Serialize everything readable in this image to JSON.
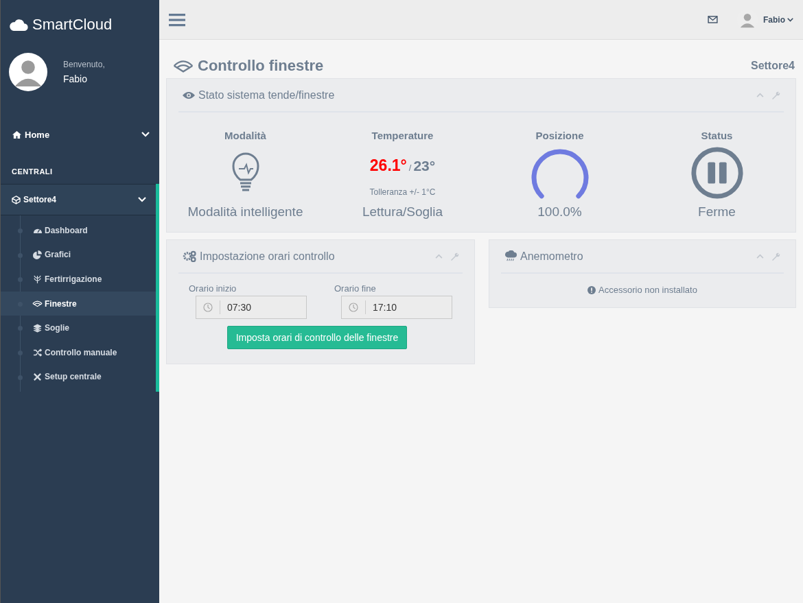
{
  "brand": "SmartCloud",
  "profile": {
    "greeting": "Benvenuto,",
    "name": "Fabio"
  },
  "nav": {
    "home": {
      "label": "Home"
    },
    "section_title": "CENTRALI",
    "group": {
      "label": "Settore4",
      "expanded": true,
      "items": [
        {
          "label": "Dashboard",
          "selected": false
        },
        {
          "label": "Grafici",
          "selected": false
        },
        {
          "label": "Fertirrigazione",
          "selected": false
        },
        {
          "label": "Finestre",
          "selected": true
        },
        {
          "label": "Soglie",
          "selected": false
        },
        {
          "label": "Controllo manuale",
          "selected": false
        },
        {
          "label": "Setup centrale",
          "selected": false
        }
      ]
    }
  },
  "topbar": {
    "user_name": "Fabio"
  },
  "page": {
    "title": "Controllo finestre",
    "breadcrumb": "Settore4"
  },
  "status_panel": {
    "title": "Stato sistema tende/finestre",
    "columns": [
      {
        "kind": "mode",
        "heading": "Modalità",
        "caption": "Modalità intelligente"
      },
      {
        "kind": "temperature",
        "heading": "Temperature",
        "reading": "26.1°",
        "separator": "/",
        "threshold": "23°",
        "note": "Tolleranza +/- 1°C",
        "caption": "Lettura/Soglia"
      },
      {
        "kind": "gauge",
        "heading": "Posizione",
        "level": 1.0,
        "caption": "100.0%"
      },
      {
        "kind": "status",
        "heading": "Status",
        "caption": "Ferme"
      }
    ]
  },
  "schedule_panel": {
    "title": "Impostazione orari controllo",
    "fields": [
      {
        "label": "Orario inizio",
        "value": "07:30"
      },
      {
        "label": "Orario fine",
        "value": "17:10"
      }
    ],
    "button": "Imposta orari di controllo delle finestre"
  },
  "anemometer_panel": {
    "title": "Anemometro",
    "message": "Accessorio non installato"
  }
}
